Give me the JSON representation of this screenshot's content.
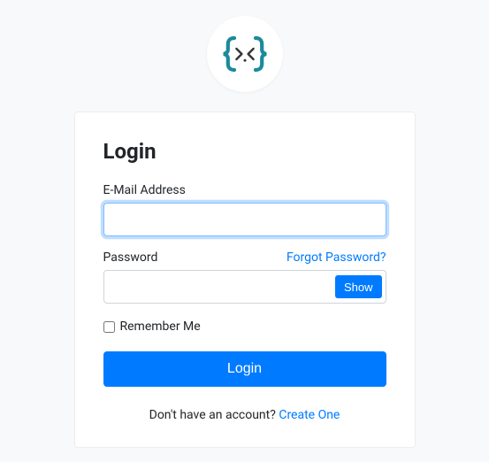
{
  "logo": {
    "name": "braces-face-logo"
  },
  "title": "Login",
  "fields": {
    "email": {
      "label": "E-Mail Address",
      "value": ""
    },
    "password": {
      "label": "Password",
      "value": "",
      "forgot_link": "Forgot Password?",
      "show_button": "Show"
    }
  },
  "remember": {
    "label": "Remember Me",
    "checked": false
  },
  "submit_label": "Login",
  "footer": {
    "text": "Don't have an account? ",
    "link_text": "Create One"
  }
}
